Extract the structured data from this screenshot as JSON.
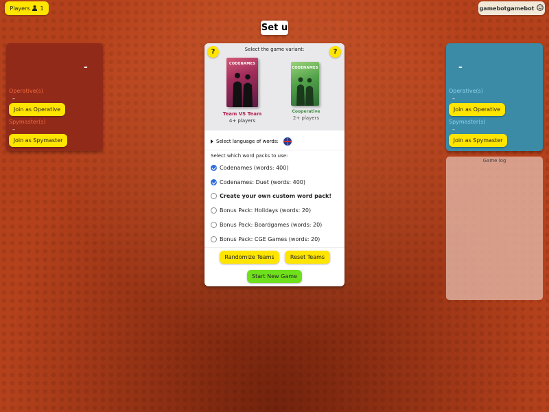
{
  "header": {
    "players_label": "Players",
    "players_count": "1",
    "username": "gamebotgamebot",
    "title": "Set u"
  },
  "red_team": {
    "score": "-",
    "operatives_label": "Operative(s)",
    "operatives_list": "–",
    "join_operative": "Join as Operative",
    "spymasters_label": "Spymaster(s)",
    "spymasters_list": "–",
    "join_spymaster": "Join as Spymaster"
  },
  "blue_team": {
    "score": "-",
    "operatives_label": "Operative(s)",
    "operatives_list": "–",
    "join_operative": "Join as Operative",
    "spymasters_label": "Spymaster(s)",
    "spymasters_list": "–",
    "join_spymaster": "Join as Spymaster"
  },
  "game_log": {
    "title": "Game log"
  },
  "setup": {
    "help_label": "?",
    "variant_prompt": "Select the game variant:",
    "box_logo": "CODENAMES",
    "variants": [
      {
        "name": "Team VS Team",
        "players": "4+ players",
        "selected": true
      },
      {
        "name": "Cooperative",
        "players": "2+ players",
        "selected": false
      }
    ],
    "language_label": "Select language of words:",
    "packs_title": "Select which word packs to use:",
    "packs": [
      {
        "label": "Codenames (words: 400)",
        "checked": true
      },
      {
        "label": "Codenames: Duet (words: 400)",
        "checked": true
      },
      {
        "label": "Create your own custom word pack!",
        "checked": false
      },
      {
        "label": "Bonus Pack: Holidays (words: 20)",
        "checked": false
      },
      {
        "label": "Bonus Pack: Boardgames (words: 20)",
        "checked": false
      },
      {
        "label": "Bonus Pack: CGE Games (words: 20)",
        "checked": false
      }
    ],
    "randomize_label": "Randomize Teams",
    "reset_label": "Reset Teams",
    "start_label": "Start New Game"
  },
  "colors": {
    "background": "#b5411c",
    "red_team": "#922a1a",
    "blue_team": "#3b8ba7",
    "button_yellow": "#ffe500",
    "start_green": "#6fe01c",
    "checkbox_blue": "#2d6cdf"
  },
  "icons": {
    "players": "person-icon",
    "user": "smiley-icon",
    "language": "uk-flag-icon",
    "expand": "triangle-right-icon"
  }
}
